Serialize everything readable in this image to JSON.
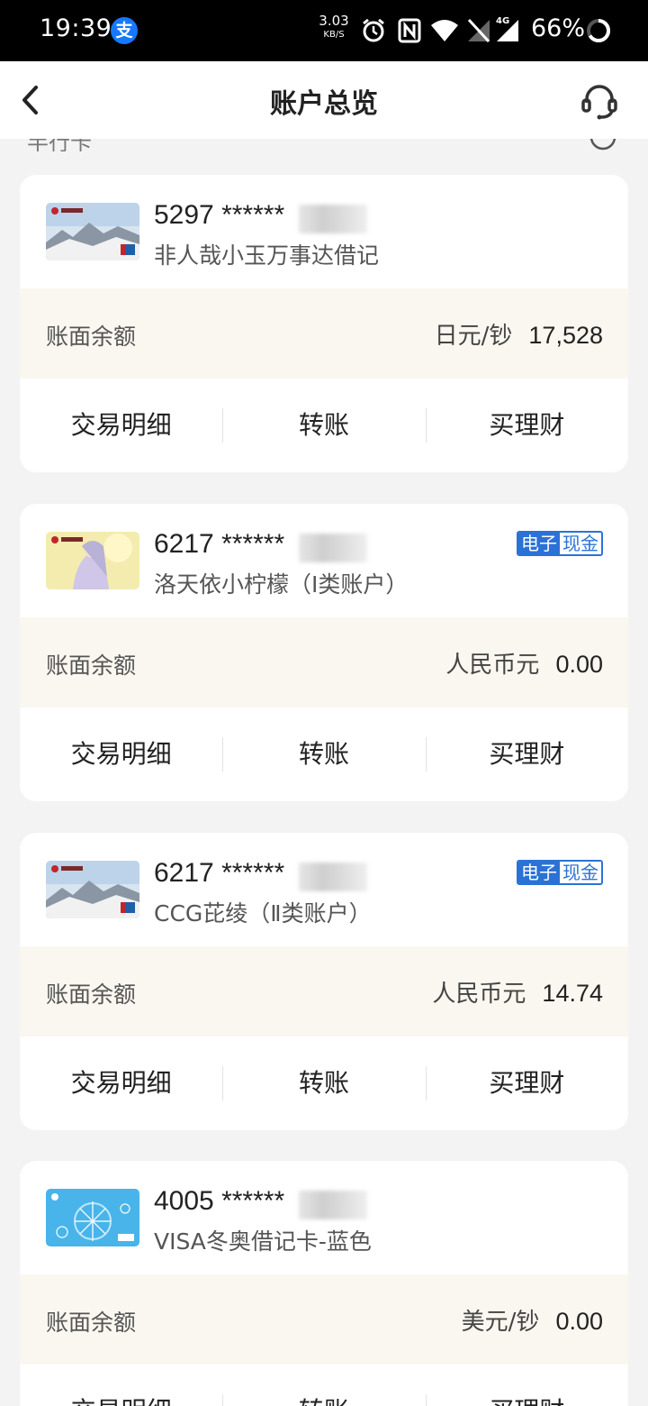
{
  "status_bar": {
    "time": "19:39",
    "alipay_icon_char": "支",
    "net_speed_value": "3.03",
    "net_speed_unit": "KB/S",
    "network_type": "4G",
    "battery": "66%"
  },
  "header": {
    "title": "账户总览"
  },
  "section_peek": {
    "label": "半行卡"
  },
  "labels": {
    "balance": "账面余额",
    "action_details": "交易明细",
    "action_transfer": "转账",
    "action_wealth": "买理财",
    "badge_left": "电子",
    "badge_right": "现金"
  },
  "cards": [
    {
      "number": "5297 ******",
      "name": "非人哉小玉万事达借记",
      "currency": "日元/钞",
      "amount": "17,528",
      "badge": false
    },
    {
      "number": "6217 ******",
      "name": "洛天依小柠檬（Ⅰ类账户）",
      "currency": "人民币元",
      "amount": "0.00",
      "badge": true
    },
    {
      "number": "6217 ******",
      "name": "CCG芘绫（Ⅱ类账户）",
      "currency": "人民币元",
      "amount": "14.74",
      "badge": true
    },
    {
      "number": "4005 ******",
      "name": "VISA冬奥借记卡-蓝色",
      "currency": "美元/钞",
      "amount": "0.00",
      "badge": false
    }
  ],
  "colors": {
    "badge_blue": "#2b72d6",
    "balance_row_bg": "#faf7f0",
    "page_bg": "#f3f3f3"
  }
}
